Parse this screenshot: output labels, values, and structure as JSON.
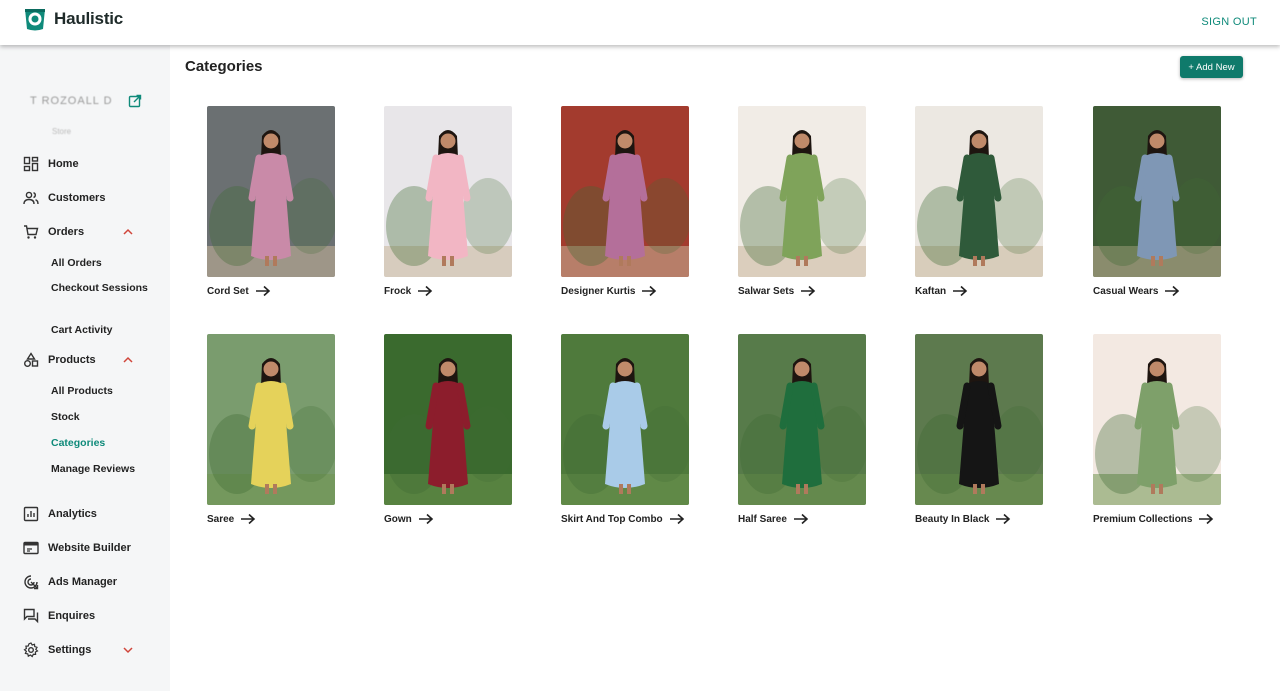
{
  "header": {
    "brand": "Haulistic",
    "signout_label": "SIGN OUT",
    "accent_color": "#0f8a7a"
  },
  "sidebar": {
    "store_name": "T ROZOALL D",
    "store_subtitle": "Store",
    "items": [
      {
        "label": "Home",
        "icon": "dashboard-icon"
      },
      {
        "label": "Customers",
        "icon": "users-icon"
      },
      {
        "label": "Orders",
        "icon": "cart-icon",
        "expanded": true
      },
      {
        "label": "Products",
        "icon": "shapes-icon",
        "expanded": true
      },
      {
        "label": "Analytics",
        "icon": "analytics-icon"
      },
      {
        "label": "Website Builder",
        "icon": "browser-icon"
      },
      {
        "label": "Ads Manager",
        "icon": "target-icon"
      },
      {
        "label": "Enquires",
        "icon": "chat-icon"
      },
      {
        "label": "Settings",
        "icon": "gear-icon",
        "expanded": false
      }
    ],
    "orders_sub": [
      "All Orders",
      "Checkout Sessions",
      "Cart Activity"
    ],
    "products_sub": [
      "All Products",
      "Stock",
      "Categories",
      "Manage Reviews"
    ],
    "active_sub": "Categories"
  },
  "main": {
    "title": "Categories",
    "add_label": "+ Add New"
  },
  "categories": [
    {
      "name": "Cord Set",
      "dress": "#c98aa8",
      "bg": "#6b7072"
    },
    {
      "name": "Frock",
      "dress": "#f2b6c4",
      "bg": "#e8e6e9"
    },
    {
      "name": "Designer Kurtis",
      "dress": "#b46f9a",
      "bg": "#a33b2e"
    },
    {
      "name": "Salwar Sets",
      "dress": "#7fa35a",
      "bg": "#f1ece6"
    },
    {
      "name": "Kaftan",
      "dress": "#2f5a3a",
      "bg": "#ece8e2"
    },
    {
      "name": "Casual Wears",
      "dress": "#7f97b5",
      "bg": "#3f5a36"
    },
    {
      "name": "Saree",
      "dress": "#e5d25a",
      "bg": "#7a9c6e"
    },
    {
      "name": "Gown",
      "dress": "#8c1d2c",
      "bg": "#3a6a2e"
    },
    {
      "name": "Skirt And Top Combo",
      "dress": "#a9cbe8",
      "bg": "#4f7a3c"
    },
    {
      "name": "Half Saree",
      "dress": "#1f6e3d",
      "bg": "#577b4a"
    },
    {
      "name": "Beauty In Black",
      "dress": "#151515",
      "bg": "#5d7a4e"
    },
    {
      "name": "Premium Collections",
      "dress": "#7ea06a",
      "bg": "#f3e9e2"
    }
  ]
}
